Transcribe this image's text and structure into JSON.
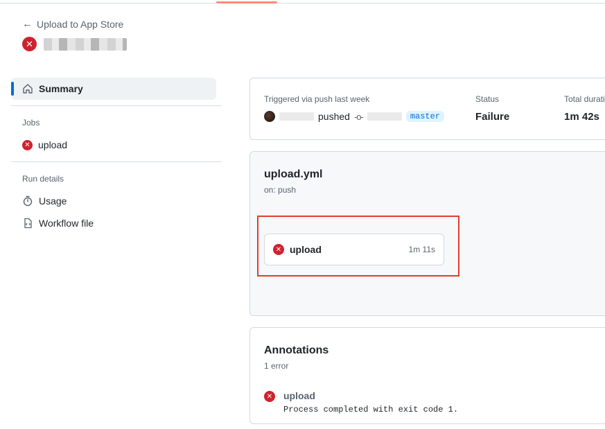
{
  "header": {
    "back_label": "Upload to App Store"
  },
  "sidebar": {
    "summary_label": "Summary",
    "jobs_heading": "Jobs",
    "jobs": [
      {
        "label": "upload",
        "status": "failure"
      }
    ],
    "run_details_heading": "Run details",
    "usage_label": "Usage",
    "workflow_file_label": "Workflow file"
  },
  "summary": {
    "trigger_text": "Triggered via push last week",
    "action_text": "pushed",
    "branch": "master",
    "status_label": "Status",
    "status_value": "Failure",
    "duration_label": "Total duration",
    "duration_value": "1m 42s"
  },
  "workflow": {
    "file_name": "upload.yml",
    "trigger": "on: push",
    "job_name": "upload",
    "job_duration": "1m 11s"
  },
  "annotations": {
    "title": "Annotations",
    "count_text": "1 error",
    "items": [
      {
        "job": "upload",
        "message": "Process completed with exit code 1."
      }
    ]
  },
  "colors": {
    "failure": "#cf222e",
    "accent": "#0969da",
    "highlight": "#e53935"
  }
}
